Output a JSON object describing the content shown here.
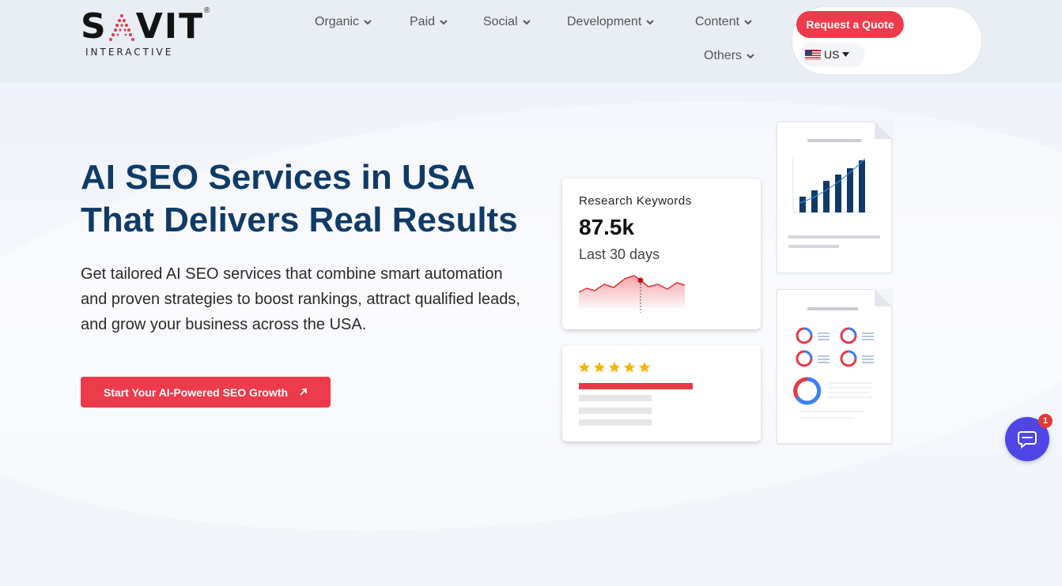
{
  "brand": {
    "name": "SAVIT",
    "tagline": "INTERACTIVE",
    "reg_mark": "®"
  },
  "nav": {
    "items": [
      {
        "label": "Organic"
      },
      {
        "label": "Paid"
      },
      {
        "label": "Social"
      },
      {
        "label": "Development"
      },
      {
        "label": "Content"
      },
      {
        "label": "Others"
      }
    ],
    "quote_button": "Request a Quote",
    "locale": "US"
  },
  "hero": {
    "title_line1": "AI SEO Services in USA",
    "title_line2": "That Delivers Real Results",
    "description": "Get tailored AI SEO services that combine smart automation and proven strategies to boost rankings, attract qualified leads, and grow your business across the USA.",
    "cta_label": "Start Your AI-Powered SEO Growth"
  },
  "stats_card": {
    "label": "Research Keywords",
    "value": "87.5k",
    "period": "Last 30 days"
  },
  "review_card": {
    "rating": 5
  },
  "chat": {
    "badge": "1"
  },
  "colors": {
    "accent": "#ee3b4b",
    "heading": "#0f3b66",
    "chart_bar": "#0f3b66",
    "chat": "#4f46e5",
    "star": "#f5b400"
  },
  "icons": [
    "chevron-down-icon",
    "us-flag-icon",
    "caret-down-icon",
    "arrow-up-right-icon",
    "star-icon",
    "chat-icon"
  ]
}
